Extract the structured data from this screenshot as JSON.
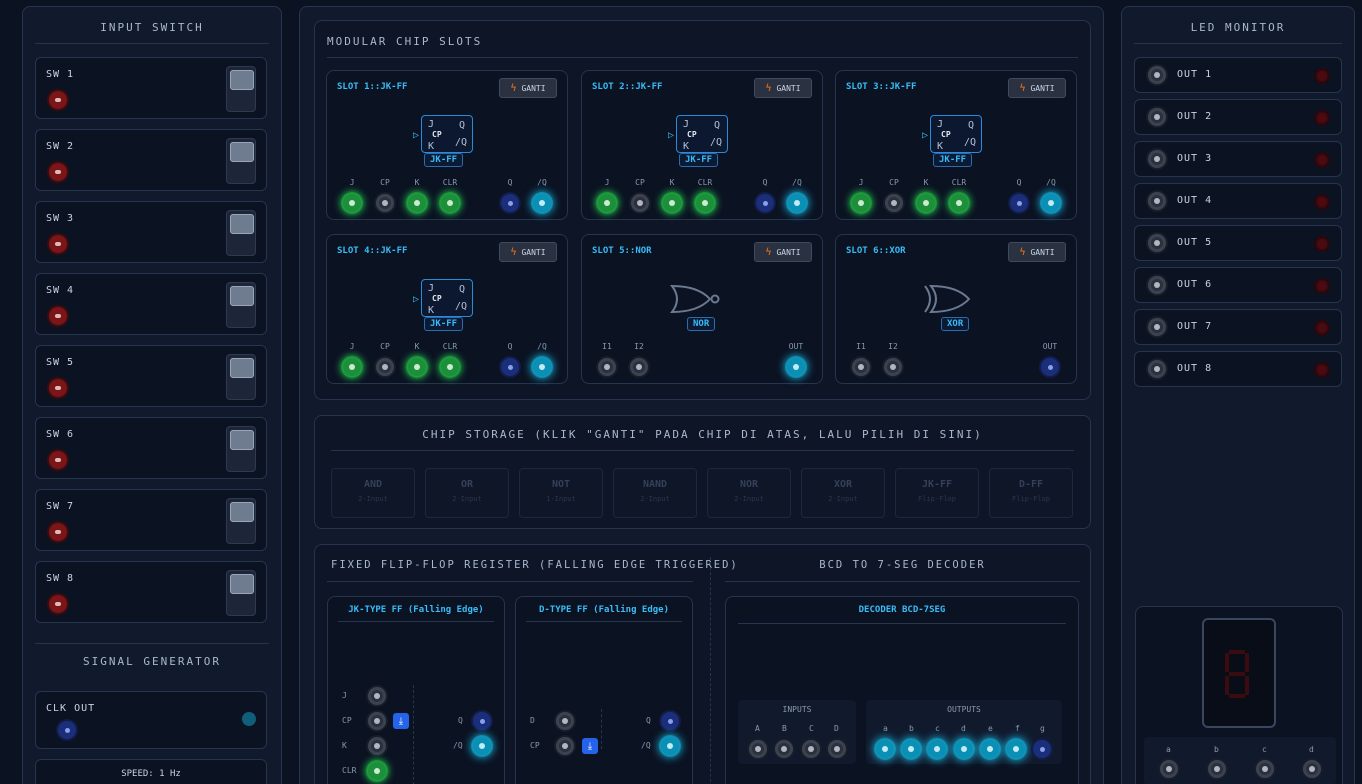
{
  "input_switch": {
    "title": "INPUT SWITCH",
    "switches": [
      "SW 1",
      "SW 2",
      "SW 3",
      "SW 4",
      "SW 5",
      "SW 6",
      "SW 7",
      "SW 8"
    ]
  },
  "signal_generator": {
    "title": "SIGNAL GENERATOR",
    "clk_label": "CLK OUT",
    "speed": "SPEED: 1 Hz"
  },
  "chip_slots": {
    "title": "MODULAR CHIP SLOTS",
    "ganti_label": "GANTI",
    "slots": [
      {
        "title": "SLOT 1::JK-FF",
        "chip": "JK-FF"
      },
      {
        "title": "SLOT 2::JK-FF",
        "chip": "JK-FF"
      },
      {
        "title": "SLOT 3::JK-FF",
        "chip": "JK-FF"
      },
      {
        "title": "SLOT 4::JK-FF",
        "chip": "JK-FF"
      },
      {
        "title": "SLOT 5::NOR",
        "chip": "NOR"
      },
      {
        "title": "SLOT 6::XOR",
        "chip": "XOR"
      }
    ],
    "jk_pins": [
      "J",
      "CP",
      "K",
      "CLR",
      "Q",
      "/Q"
    ],
    "gate_pins": [
      "I1",
      "I2",
      "OUT"
    ],
    "jk_symbol": {
      "j": "J",
      "q": "Q",
      "cp": "CP",
      "k": "K",
      "nq": "/Q"
    }
  },
  "chip_storage": {
    "title": "CHIP STORAGE (KLIK \"GANTI\" PADA CHIP DI ATAS, LALU PILIH DI SINI)",
    "items": [
      {
        "name": "AND",
        "sub": "2-Input"
      },
      {
        "name": "OR",
        "sub": "2-Input"
      },
      {
        "name": "NOT",
        "sub": "1-Input"
      },
      {
        "name": "NAND",
        "sub": "2-Input"
      },
      {
        "name": "NOR",
        "sub": "2-Input"
      },
      {
        "name": "XOR",
        "sub": "2-Input"
      },
      {
        "name": "JK-FF",
        "sub": "Flip-Flop"
      },
      {
        "name": "D-FF",
        "sub": "Flip-Flop"
      }
    ]
  },
  "fixed_ff": {
    "title": "FIXED FLIP-FLOP REGISTER (FALLING EDGE TRIGGERED)",
    "jk_title": "JK-TYPE FF (Falling Edge)",
    "d_title": "D-TYPE FF (Falling Edge)",
    "jk_pins": [
      "J",
      "CP",
      "K",
      "CLR",
      "Q",
      "/Q"
    ],
    "d_pins": [
      "D",
      "CP",
      "Q",
      "/Q"
    ]
  },
  "decoder": {
    "title": "BCD TO 7-SEG DECODER",
    "box_title": "DECODER BCD-7SEG",
    "inputs_label": "INPUTS",
    "outputs_label": "OUTPUTS",
    "inputs": [
      "A",
      "B",
      "C",
      "D"
    ],
    "outputs": [
      "a",
      "b",
      "c",
      "d",
      "e",
      "f",
      "g"
    ]
  },
  "led_monitor": {
    "title": "LED MONITOR",
    "outputs": [
      "OUT 1",
      "OUT 2",
      "OUT 3",
      "OUT 4",
      "OUT 5",
      "OUT 6",
      "OUT 7",
      "OUT 8"
    ],
    "display_pins": [
      "a",
      "b",
      "c",
      "d"
    ]
  },
  "icons": {
    "ganti": "lightning-bolt-icon",
    "clock_button": "falling-edge-icon"
  },
  "colors": {
    "accent": "#38bdf8",
    "on_green": "#27e055",
    "on_cyan": "#1cc6f2",
    "led_off": "#4a0c12"
  }
}
